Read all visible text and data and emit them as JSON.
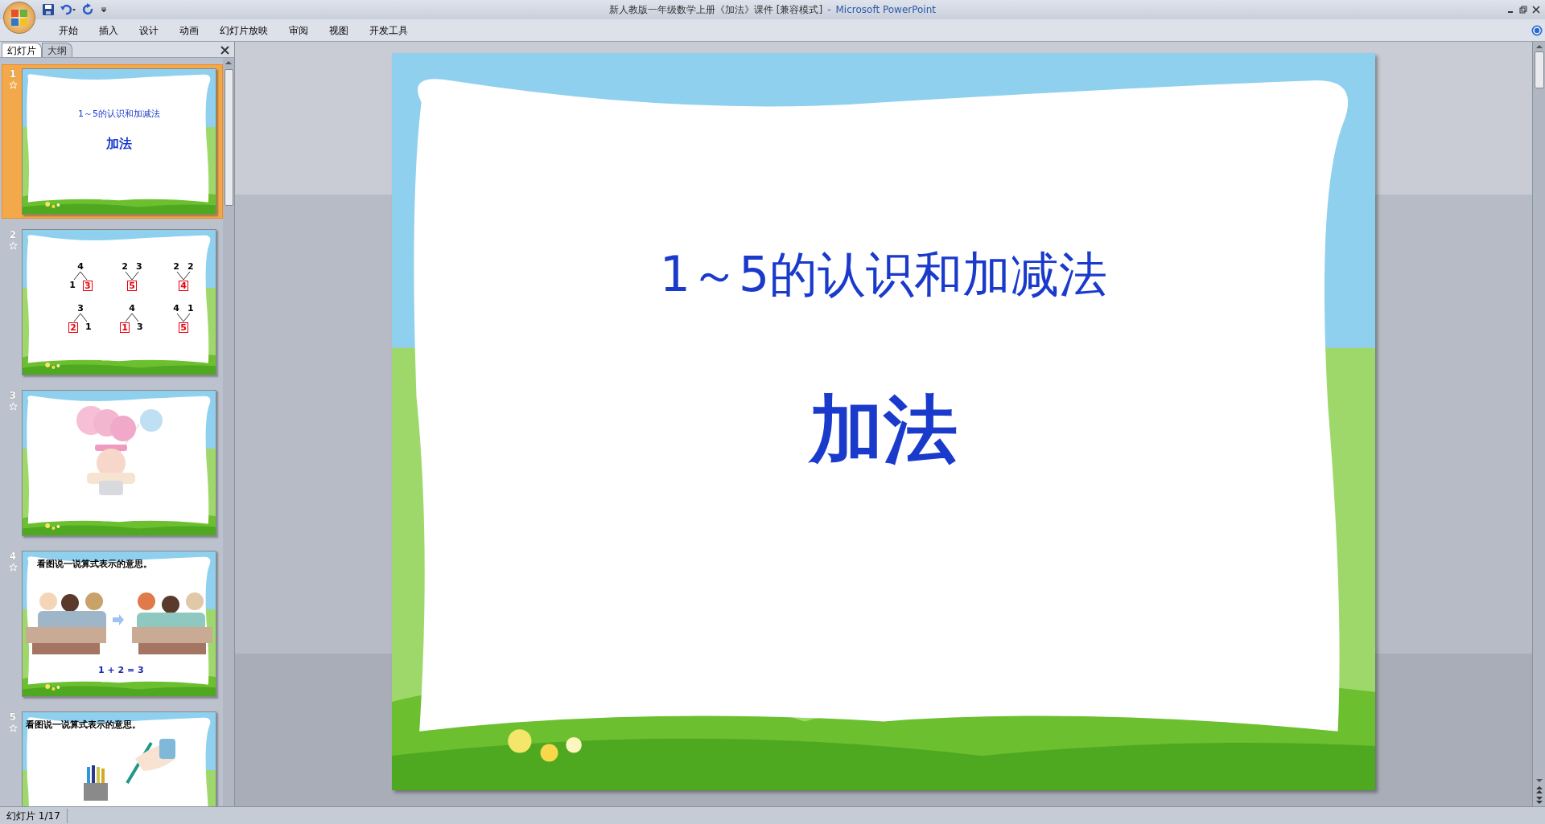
{
  "window": {
    "title": "新人教版一年级数学上册《加法》课件 [兼容模式]",
    "separator": "-",
    "app": "Microsoft PowerPoint"
  },
  "ribbon_tabs": [
    {
      "label": "开始"
    },
    {
      "label": "插入"
    },
    {
      "label": "设计"
    },
    {
      "label": "动画"
    },
    {
      "label": "幻灯片放映"
    },
    {
      "label": "审阅"
    },
    {
      "label": "视图"
    },
    {
      "label": "开发工具"
    }
  ],
  "panel": {
    "tabs": [
      {
        "label": "幻灯片",
        "selected": true
      },
      {
        "label": "大纲",
        "selected": false
      }
    ],
    "slides": [
      {
        "number": "1",
        "selected": true,
        "kind": "title",
        "title": "1～5的认识和加减法",
        "subtitle": "加法"
      },
      {
        "number": "2",
        "selected": false,
        "kind": "bonds",
        "bonds": [
          {
            "top": [
              {
                "text": "4",
                "boxed": false
              }
            ],
            "bottom": [
              {
                "text": "1",
                "boxed": false
              },
              {
                "text": "3",
                "boxed": true
              }
            ]
          },
          {
            "top": [
              {
                "text": "2",
                "boxed": false
              },
              {
                "text": "3",
                "boxed": false
              }
            ],
            "bottom": [
              {
                "text": "5",
                "boxed": true
              }
            ]
          },
          {
            "top": [
              {
                "text": "2",
                "boxed": false
              },
              {
                "text": "2",
                "boxed": false
              }
            ],
            "bottom": [
              {
                "text": "4",
                "boxed": true
              }
            ]
          },
          {
            "top": [
              {
                "text": "3",
                "boxed": false
              }
            ],
            "bottom": [
              {
                "text": "2",
                "boxed": true
              },
              {
                "text": "1",
                "boxed": false
              }
            ]
          },
          {
            "top": [
              {
                "text": "4",
                "boxed": false
              }
            ],
            "bottom": [
              {
                "text": "1",
                "boxed": true
              },
              {
                "text": "3",
                "boxed": false
              }
            ]
          },
          {
            "top": [
              {
                "text": "4",
                "boxed": false
              },
              {
                "text": "1",
                "boxed": false
              }
            ],
            "bottom": [
              {
                "text": "5",
                "boxed": true
              }
            ]
          }
        ]
      },
      {
        "number": "3",
        "selected": false,
        "kind": "picture"
      },
      {
        "number": "4",
        "selected": false,
        "kind": "caption_picture",
        "caption": "看图说一说算式表示的意思。",
        "equation": "1 + 2 = 3"
      },
      {
        "number": "5",
        "selected": false,
        "kind": "caption_picture",
        "caption": "看图说一说算式表示的意思。"
      }
    ]
  },
  "slide": {
    "title": "1～5的认识和加减法",
    "subtitle": "加法"
  },
  "status_bar": {
    "text": "幻灯片 1/17"
  }
}
